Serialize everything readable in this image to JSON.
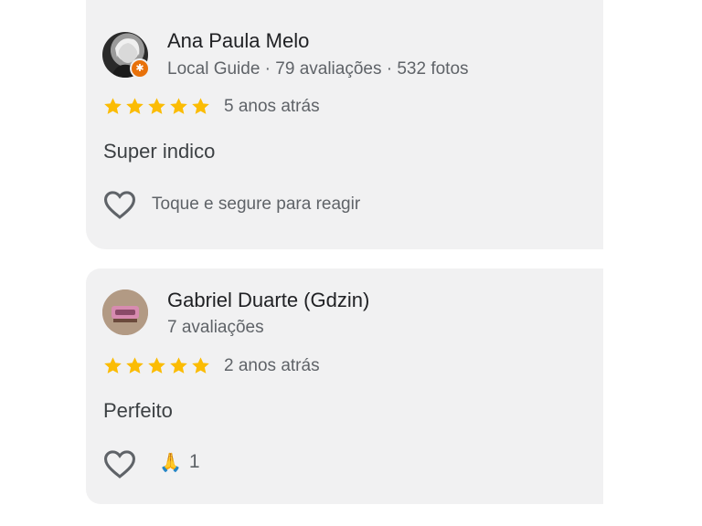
{
  "reviews": [
    {
      "author": "Ana Paula Melo",
      "meta": "Local Guide · 79 avaliações · 532 fotos",
      "rating": 5,
      "time": "5 anos atrás",
      "text": "Super indico",
      "react_hint": "Toque e segure para reagir",
      "avatar_icon": "user-photo-icon",
      "badge_icon": "local-guide-star-icon"
    },
    {
      "author": "Gabriel Duarte (Gdzin)",
      "meta": "7 avaliações",
      "rating": 5,
      "time": "2 anos atrás",
      "text": "Perfeito",
      "reaction_emoji": "🙏",
      "reaction_count": "1",
      "avatar_icon": "user-photo-icon"
    }
  ],
  "colors": {
    "card_bg": "#f1f1f2",
    "star": "#fbbc04",
    "badge": "#e8710a",
    "text_primary": "#202124",
    "text_secondary": "#5f6368"
  }
}
